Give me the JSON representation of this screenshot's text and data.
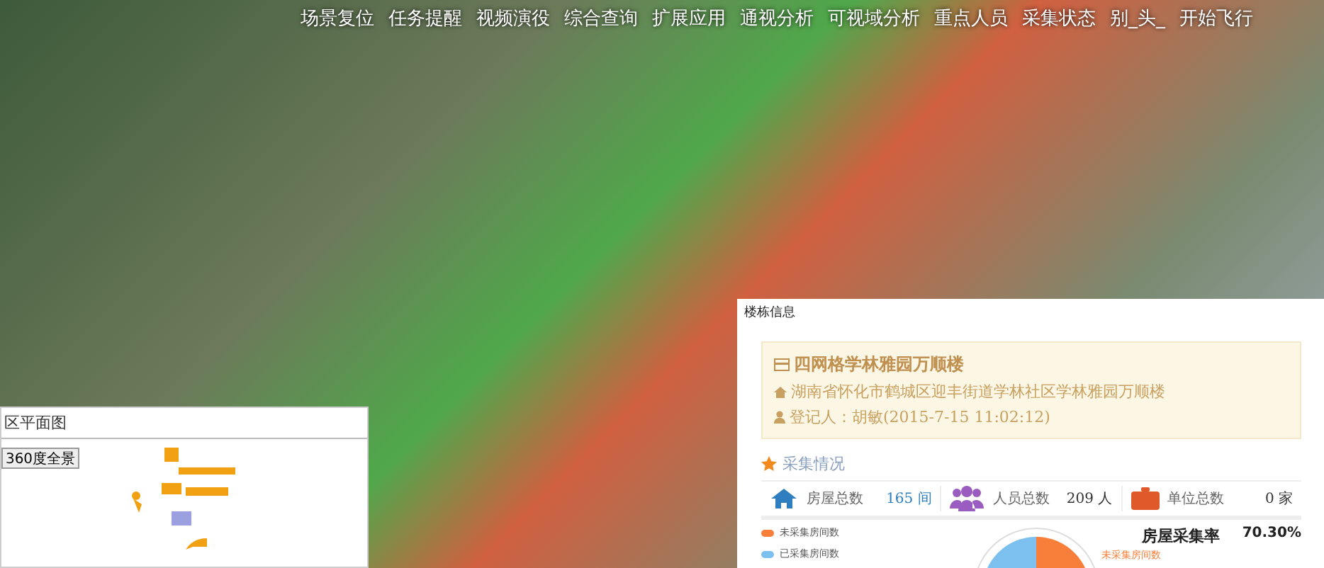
{
  "menu": [
    {
      "label": "场景复位"
    },
    {
      "label": "任务提醒"
    },
    {
      "label": "视频演役"
    },
    {
      "label": "综合查询"
    },
    {
      "label": "扩展应用"
    },
    {
      "label": "通视分析"
    },
    {
      "label": "可视域分析"
    },
    {
      "label": "重点人员"
    },
    {
      "label": "采集状态"
    },
    {
      "label": "别_头_"
    },
    {
      "label": "开始飞行"
    }
  ],
  "plan_panel": {
    "title": "区平面图",
    "button": "360度全景"
  },
  "building_panel": {
    "title": "楼栋信息",
    "info": {
      "name": "四网格学林雅园万顺楼",
      "address": "湖南省怀化市鹤城区迎丰街道学林社区学林雅园万顺楼",
      "registrant": "登记人：胡敏(2015-7-15 11:02:12)"
    },
    "section": "采集情况",
    "stats": [
      {
        "kind": "house",
        "label": "房屋总数",
        "value": "165 间"
      },
      {
        "kind": "people",
        "label": "人员总数",
        "value": "209 人"
      },
      {
        "kind": "unit",
        "label": "单位总数",
        "value": "0 家"
      }
    ],
    "legend": [
      {
        "label": "未采集房间数",
        "color": "#f77f3a"
      },
      {
        "label": "已采集房间数",
        "color": "#7cc0f0"
      }
    ],
    "pie_label": "未采集房间数",
    "rate_label": "房屋采集率",
    "rate_value": "70.30%"
  }
}
